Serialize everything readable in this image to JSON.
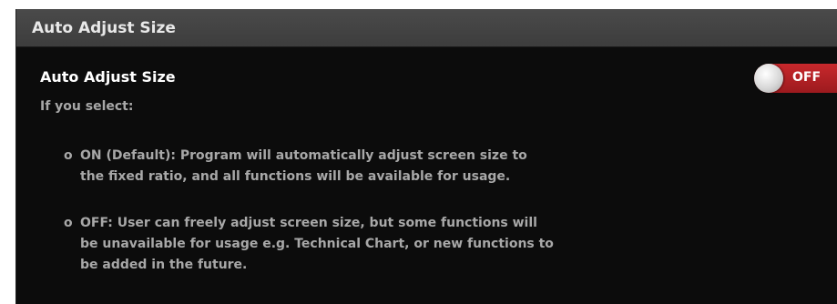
{
  "panel": {
    "title": "Auto Adjust Size"
  },
  "setting": {
    "label": "Auto Adjust Size",
    "toggle_state": "OFF",
    "intro": "If you select:"
  },
  "options": [
    {
      "bullet": "o",
      "lines": [
        "ON (Default): Program will automatically adjust screen size to",
        "the fixed ratio, and all functions will be available for usage."
      ]
    },
    {
      "bullet": "o",
      "lines": [
        "OFF: User can freely adjust screen size, but some functions will",
        "be unavailable for usage e.g. Technical Chart, or new functions to",
        "be added in the future."
      ]
    }
  ],
  "colors": {
    "panel_bg": "#0c0c0c",
    "header_bg": "#444444",
    "toggle_off": "#b42024",
    "muted_text": "#a8a8a8"
  }
}
